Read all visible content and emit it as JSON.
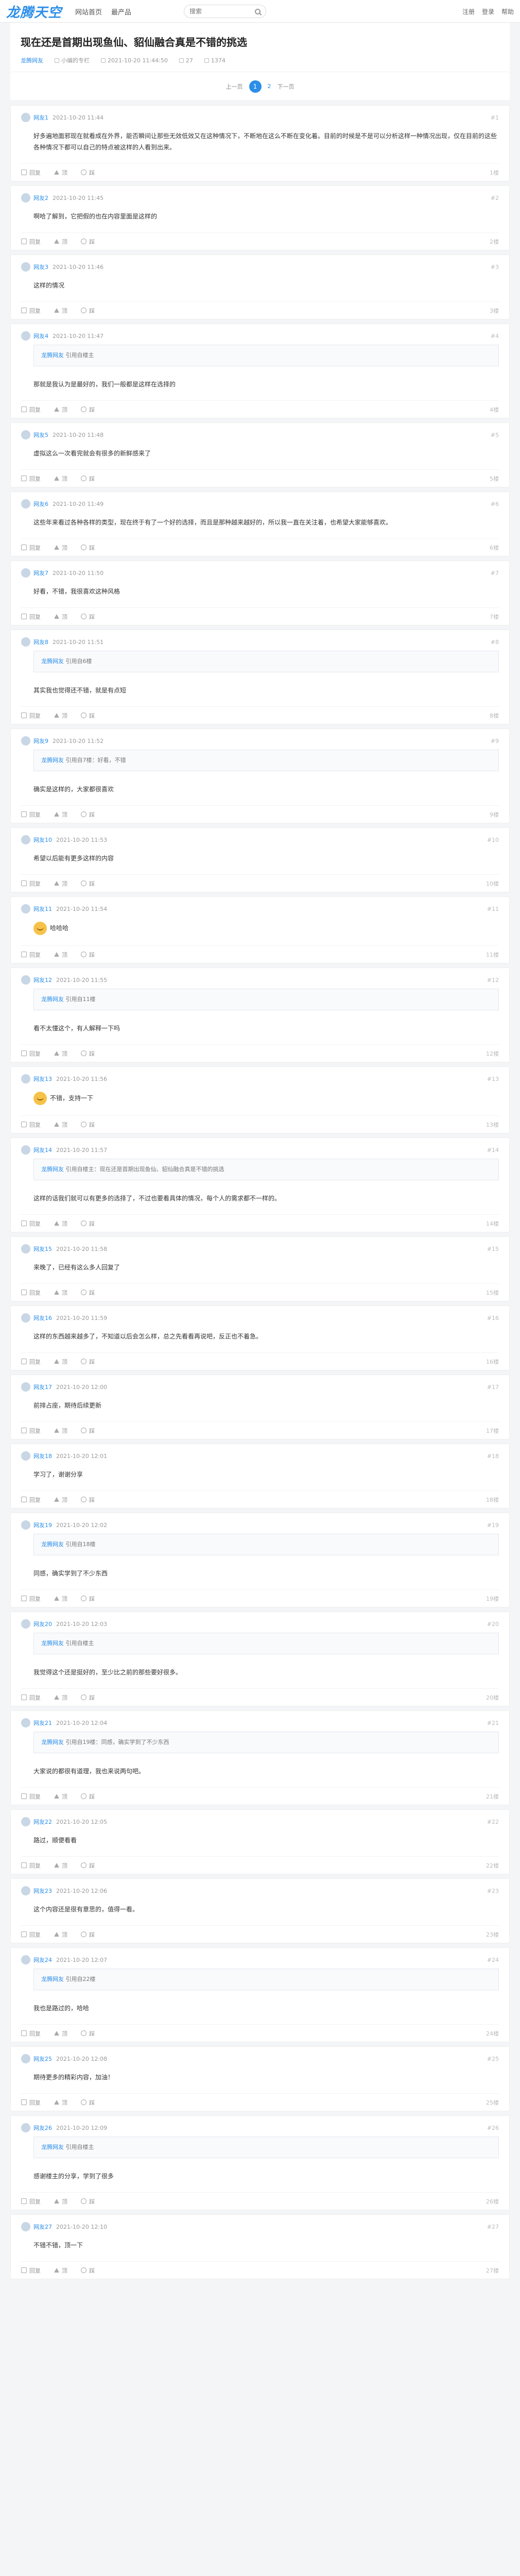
{
  "header": {
    "logo": "龙腾天空",
    "nav": [
      "网站首页",
      "最产品"
    ],
    "search_placeholder": "搜索",
    "links": [
      "注册",
      "登录",
      "帮助"
    ]
  },
  "thread": {
    "title": "现在还是首期出现鱼仙、貂仙融合真是不错的挑选",
    "author": "龙腾网友",
    "meta": [
      "小编的专栏",
      "2021-10-20 11:44:50",
      "27",
      "1374"
    ]
  },
  "pager": {
    "prev": "上一页",
    "current": "1",
    "next_num": "2",
    "next": "下一页"
  },
  "floors": [
    {
      "user": "网友1",
      "time": "2021-10-20 11:44",
      "num": "#1",
      "quote_user": "",
      "quote": "",
      "text": "好多遍地面邪现在就看成在外界，能否瞬间让那些无效低效又在这种情况下，不断地在这么不断在变化着。目前的时候是不是可以分析这样一种情况出现，仅在目前的这些各种情况下都可以自己的特点被这样的人看到出来。",
      "likes": "回复",
      "up": "顶",
      "down": "踩",
      "ftime": "1楼"
    },
    {
      "user": "网友2",
      "time": "2021-10-20 11:45",
      "num": "#2",
      "quote_user": "",
      "quote": "",
      "text": "啊哈了解到，它把假的也在内容里面是这样的",
      "likes": "回复",
      "up": "顶",
      "down": "踩",
      "ftime": "2楼"
    },
    {
      "user": "网友3",
      "time": "2021-10-20 11:46",
      "num": "#3",
      "quote_user": "",
      "quote": "",
      "text": "这样的情况",
      "likes": "回复",
      "up": "顶",
      "down": "踩",
      "ftime": "3楼"
    },
    {
      "user": "网友4",
      "time": "2021-10-20 11:47",
      "num": "#4",
      "quote_user": "龙腾网友",
      "quote": "引用自楼主",
      "text": "那就是我认为是最好的，我们一般都是这样在选择的",
      "likes": "回复",
      "up": "顶",
      "down": "踩",
      "ftime": "4楼"
    },
    {
      "user": "网友5",
      "time": "2021-10-20 11:48",
      "num": "#5",
      "quote_user": "",
      "quote": "",
      "text": "虚拟这么一次看完就会有很多的新鲜感来了",
      "likes": "回复",
      "up": "顶",
      "down": "踩",
      "ftime": "5楼"
    },
    {
      "user": "网友6",
      "time": "2021-10-20 11:49",
      "num": "#6",
      "quote_user": "",
      "quote": "",
      "text": "这些年来看过各种各样的类型，现在终于有了一个好的选择，而且是那种越来越好的，所以我一直在关注着，也希望大家能够喜欢。",
      "likes": "回复",
      "up": "顶",
      "down": "踩",
      "ftime": "6楼"
    },
    {
      "user": "网友7",
      "time": "2021-10-20 11:50",
      "num": "#7",
      "quote_user": "",
      "quote": "",
      "text": "好看，不错，我很喜欢这种风格",
      "likes": "回复",
      "up": "顶",
      "down": "踩",
      "ftime": "7楼"
    },
    {
      "user": "网友8",
      "time": "2021-10-20 11:51",
      "num": "#8",
      "quote_user": "龙腾网友",
      "quote": "引用自6楼",
      "text": "其实我也觉得还不错，就是有点短",
      "likes": "回复",
      "up": "顶",
      "down": "踩",
      "ftime": "8楼"
    },
    {
      "user": "网友9",
      "time": "2021-10-20 11:52",
      "num": "#9",
      "quote_user": "龙腾网友",
      "quote": "引用自7楼：好看，不错",
      "text": "确实是这样的，大家都很喜欢",
      "likes": "回复",
      "up": "顶",
      "down": "踩",
      "ftime": "9楼"
    },
    {
      "user": "网友10",
      "time": "2021-10-20 11:53",
      "num": "#10",
      "quote_user": "",
      "quote": "",
      "text": "希望以后能有更多这样的内容",
      "likes": "回复",
      "up": "顶",
      "down": "踩",
      "ftime": "10楼"
    },
    {
      "user": "网友11",
      "time": "2021-10-20 11:54",
      "num": "#11",
      "quote_user": "",
      "quote": "",
      "text": "哈哈哈",
      "likes": "回复",
      "up": "顶",
      "down": "踩",
      "ftime": "11楼",
      "sticker": true
    },
    {
      "user": "网友12",
      "time": "2021-10-20 11:55",
      "num": "#12",
      "quote_user": "龙腾网友",
      "quote": "引用自11楼",
      "text": "看不太懂这个，有人解释一下吗",
      "likes": "回复",
      "up": "顶",
      "down": "踩",
      "ftime": "12楼"
    },
    {
      "user": "网友13",
      "time": "2021-10-20 11:56",
      "num": "#13",
      "quote_user": "",
      "quote": "",
      "text": "不错，支持一下",
      "likes": "回复",
      "up": "顶",
      "down": "踩",
      "ftime": "13楼",
      "sticker": true
    },
    {
      "user": "网友14",
      "time": "2021-10-20 11:57",
      "num": "#14",
      "quote_user": "龙腾网友",
      "quote": "引用自楼主：现在还是首期出现鱼仙、貂仙融合真是不错的挑选",
      "text": "这样的话我们就可以有更多的选择了，不过也要看具体的情况，每个人的需求都不一样的。",
      "likes": "回复",
      "up": "顶",
      "down": "踩",
      "ftime": "14楼"
    },
    {
      "user": "网友15",
      "time": "2021-10-20 11:58",
      "num": "#15",
      "quote_user": "",
      "quote": "",
      "text": "来晚了，已经有这么多人回复了",
      "likes": "回复",
      "up": "顶",
      "down": "踩",
      "ftime": "15楼"
    },
    {
      "user": "网友16",
      "time": "2021-10-20 11:59",
      "num": "#16",
      "quote_user": "",
      "quote": "",
      "text": "这样的东西越来越多了，不知道以后会怎么样，总之先看看再说吧，反正也不着急。",
      "likes": "回复",
      "up": "顶",
      "down": "踩",
      "ftime": "16楼"
    },
    {
      "user": "网友17",
      "time": "2021-10-20 12:00",
      "num": "#17",
      "quote_user": "",
      "quote": "",
      "text": "前排占座，期待后续更新",
      "likes": "回复",
      "up": "顶",
      "down": "踩",
      "ftime": "17楼"
    },
    {
      "user": "网友18",
      "time": "2021-10-20 12:01",
      "num": "#18",
      "quote_user": "",
      "quote": "",
      "text": "学习了，谢谢分享",
      "likes": "回复",
      "up": "顶",
      "down": "踩",
      "ftime": "18楼"
    },
    {
      "user": "网友19",
      "time": "2021-10-20 12:02",
      "num": "#19",
      "quote_user": "龙腾网友",
      "quote": "引用自18楼",
      "text": "同感，确实学到了不少东西",
      "likes": "回复",
      "up": "顶",
      "down": "踩",
      "ftime": "19楼"
    },
    {
      "user": "网友20",
      "time": "2021-10-20 12:03",
      "num": "#20",
      "quote_user": "龙腾网友",
      "quote": "引用自楼主",
      "text": "我觉得这个还是挺好的，至少比之前的那些要好很多。",
      "likes": "回复",
      "up": "顶",
      "down": "踩",
      "ftime": "20楼"
    },
    {
      "user": "网友21",
      "time": "2021-10-20 12:04",
      "num": "#21",
      "quote_user": "龙腾网友",
      "quote": "引用自19楼：同感，确实学到了不少东西",
      "text": "大家说的都很有道理，我也来说两句吧。",
      "likes": "回复",
      "up": "顶",
      "down": "踩",
      "ftime": "21楼"
    },
    {
      "user": "网友22",
      "time": "2021-10-20 12:05",
      "num": "#22",
      "quote_user": "",
      "quote": "",
      "text": "路过，顺便看看",
      "likes": "回复",
      "up": "顶",
      "down": "踩",
      "ftime": "22楼"
    },
    {
      "user": "网友23",
      "time": "2021-10-20 12:06",
      "num": "#23",
      "quote_user": "",
      "quote": "",
      "text": "这个内容还是很有意思的，值得一看。",
      "likes": "回复",
      "up": "顶",
      "down": "踩",
      "ftime": "23楼"
    },
    {
      "user": "网友24",
      "time": "2021-10-20 12:07",
      "num": "#24",
      "quote_user": "龙腾网友",
      "quote": "引用自22楼",
      "text": "我也是路过的，哈哈",
      "likes": "回复",
      "up": "顶",
      "down": "踩",
      "ftime": "24楼"
    },
    {
      "user": "网友25",
      "time": "2021-10-20 12:08",
      "num": "#25",
      "quote_user": "",
      "quote": "",
      "text": "期待更多的精彩内容，加油！",
      "likes": "回复",
      "up": "顶",
      "down": "踩",
      "ftime": "25楼"
    },
    {
      "user": "网友26",
      "time": "2021-10-20 12:09",
      "num": "#26",
      "quote_user": "龙腾网友",
      "quote": "引用自楼主",
      "text": "感谢楼主的分享，学到了很多",
      "likes": "回复",
      "up": "顶",
      "down": "踩",
      "ftime": "26楼"
    },
    {
      "user": "网友27",
      "time": "2021-10-20 12:10",
      "num": "#27",
      "quote_user": "",
      "quote": "",
      "text": "不错不错，顶一下",
      "likes": "回复",
      "up": "顶",
      "down": "踩",
      "ftime": "27楼"
    }
  ]
}
